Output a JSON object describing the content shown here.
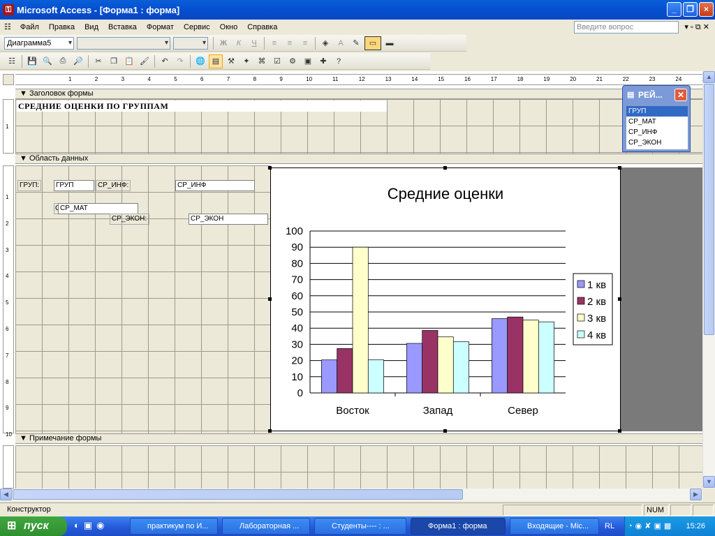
{
  "window": {
    "title": "Microsoft Access - [Форма1 : форма]"
  },
  "menu": [
    "Файл",
    "Правка",
    "Вид",
    "Вставка",
    "Формат",
    "Сервис",
    "Окно",
    "Справка"
  ],
  "help_placeholder": "Введите вопрос",
  "toolbar1": {
    "object_combo": "Диаграмма5",
    "font_combo": "",
    "size_combo": ""
  },
  "ruler": {
    "numbers": [
      "1",
      "2",
      "3",
      "4",
      "5",
      "6",
      "7",
      "8",
      "9",
      "10",
      "11",
      "12",
      "13",
      "14",
      "15",
      "16",
      "17",
      "18",
      "19",
      "20",
      "21",
      "22",
      "23",
      "24",
      "25"
    ]
  },
  "ruler_left": {
    "header": [
      "1"
    ],
    "detail": [
      "1",
      "2",
      "3",
      "4",
      "5",
      "6",
      "7",
      "8",
      "9",
      "10"
    ]
  },
  "sections": {
    "header": "Заголовок формы",
    "detail": "Область данных",
    "footer": "Примечание формы"
  },
  "form_header_title": "СРЕДНИЕ ОЦЕНКИ ПО ГРУППАМ",
  "controls": {
    "label_grup": "ГРУП:",
    "field_grup": "ГРУП",
    "label_inf": "СР_ИНФ:",
    "field_inf": "СР_ИНФ",
    "label_mat_prefix": "С",
    "field_mat": "СР_МАТ",
    "label_econ": "СР_ЭКОН:",
    "field_econ": "СР_ЭКОН"
  },
  "field_list": {
    "title": "РЕЙ...",
    "items": [
      "ГРУП",
      "СР_МАТ",
      "СР_ИНФ",
      "СР_ЭКОН"
    ],
    "selected": "ГРУП"
  },
  "chart_data": {
    "type": "bar",
    "title": "Средние оценки",
    "categories": [
      "Восток",
      "Запад",
      "Север"
    ],
    "series": [
      {
        "name": "1 кв",
        "color": "#9999ff",
        "values": [
          20.4,
          30.6,
          45.9
        ]
      },
      {
        "name": "2 кв",
        "color": "#993366",
        "values": [
          27.4,
          38.6,
          46.9
        ]
      },
      {
        "name": "3 кв",
        "color": "#ffffcc",
        "values": [
          90,
          34.6,
          45
        ]
      },
      {
        "name": "4 кв",
        "color": "#ccffff",
        "values": [
          20.4,
          31.6,
          43.9
        ]
      }
    ],
    "ylim": [
      0,
      100
    ],
    "yticks": [
      "0",
      "10",
      "20",
      "30",
      "40",
      "50",
      "60",
      "70",
      "80",
      "90",
      "100"
    ],
    "grid": true,
    "legend": "right"
  },
  "status": {
    "mode": "Конструктор",
    "num": "NUM"
  },
  "taskbar": {
    "start": "пуск",
    "tasks": [
      "практикум по И...",
      "Лабораторная ...",
      "Студенты---- : ...",
      "Форма1 : форма",
      "Входящие - Mic..."
    ],
    "active_task": "Форма1 : форма",
    "lang": "RL",
    "clock": "15:26"
  }
}
